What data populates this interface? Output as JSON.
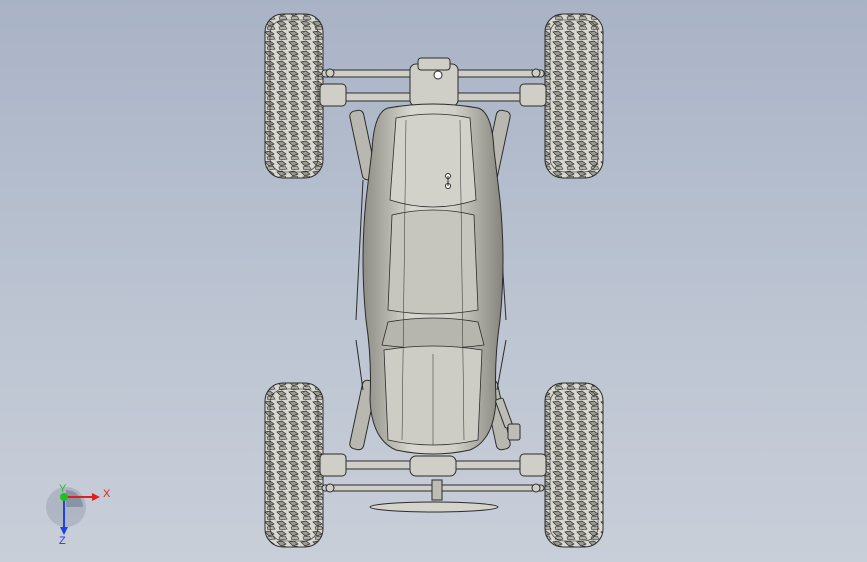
{
  "view": {
    "background_top": "#a9b3c6",
    "background_bottom": "#c9cfd9",
    "model_fill": "#c8c8c0",
    "model_edge": "#2b2b2b"
  },
  "triad": {
    "x_label": "X",
    "y_label": "Y",
    "z_label": "Z",
    "x_color": "#e02020",
    "y_color": "#20c020",
    "z_color": "#2040e0"
  }
}
